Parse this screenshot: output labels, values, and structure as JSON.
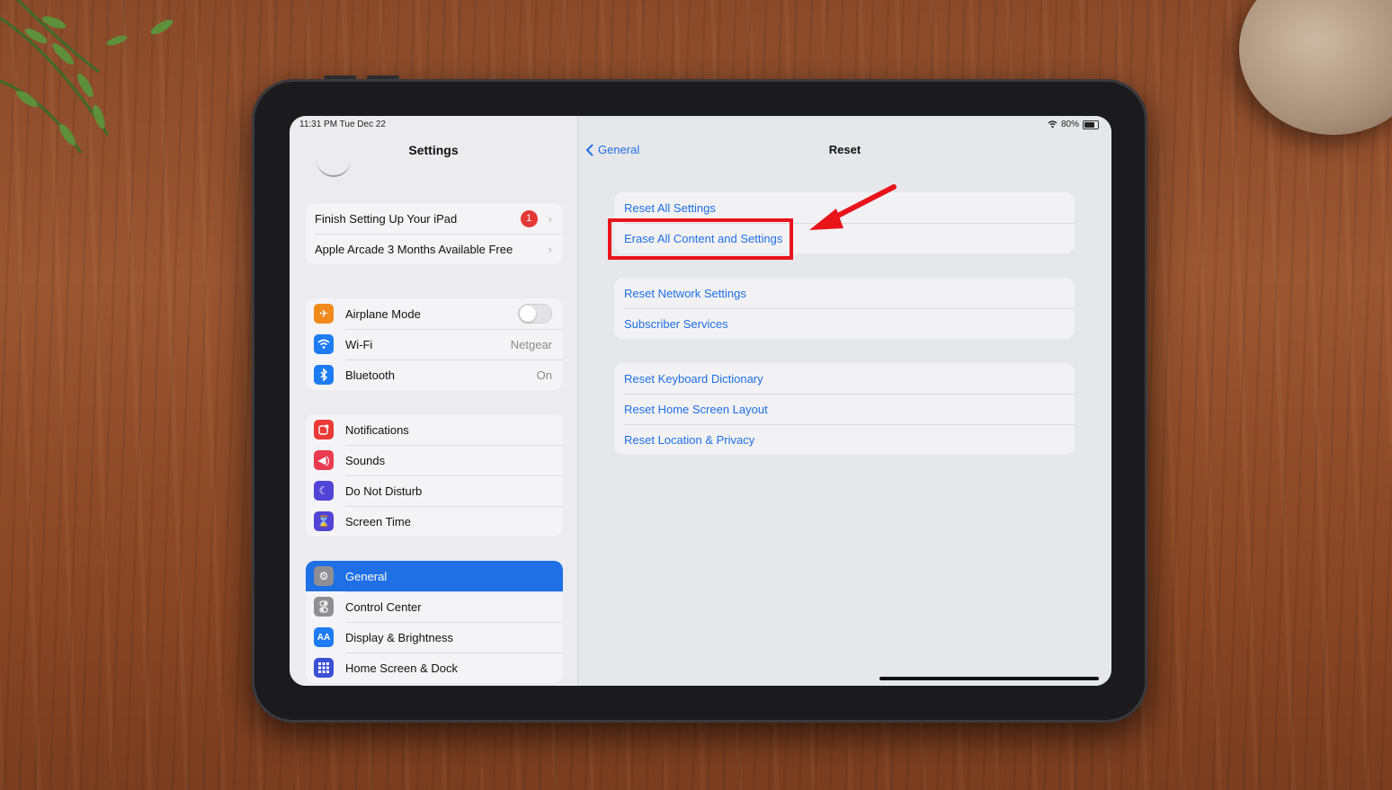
{
  "status_bar": {
    "time": "11:31 PM  Tue Dec 22",
    "battery": "80%"
  },
  "sidebar": {
    "title": "Settings",
    "promo_items": [
      {
        "label": "Finish Setting Up Your iPad",
        "badge": "1"
      },
      {
        "label": "Apple Arcade 3 Months Available Free"
      }
    ],
    "connectivity": [
      {
        "label": "Airplane Mode",
        "icon": "airplane-icon",
        "color": "#f08a1c"
      },
      {
        "label": "Wi-Fi",
        "value": "Netgear",
        "icon": "wifi-icon",
        "color": "#1e7cf2"
      },
      {
        "label": "Bluetooth",
        "value": "On",
        "icon": "bluetooth-icon",
        "color": "#1e7cf2"
      }
    ],
    "notifications": [
      {
        "label": "Notifications",
        "icon": "notifications-icon",
        "color": "#ea3b37"
      },
      {
        "label": "Sounds",
        "icon": "speaker-icon",
        "color": "#ea3b50"
      },
      {
        "label": "Do Not Disturb",
        "icon": "moon-icon",
        "color": "#5144d6"
      },
      {
        "label": "Screen Time",
        "icon": "hourglass-icon",
        "color": "#5144d6"
      }
    ],
    "general": [
      {
        "label": "General",
        "icon": "gear-icon",
        "color": "#8e8e93",
        "selected": true
      },
      {
        "label": "Control Center",
        "icon": "toggles-icon",
        "color": "#8e8e93"
      },
      {
        "label": "Display & Brightness",
        "icon": "text-size-icon",
        "color": "#1e7cf2"
      },
      {
        "label": "Home Screen & Dock",
        "icon": "grid-icon",
        "color": "#3b50d6"
      }
    ]
  },
  "main": {
    "back_label": "General",
    "title": "Reset",
    "group1": [
      "Reset All Settings",
      "Erase All Content and Settings"
    ],
    "group2": [
      "Reset Network Settings",
      "Subscriber Services"
    ],
    "group3": [
      "Reset Keyboard Dictionary",
      "Reset Home Screen Layout",
      "Reset Location & Privacy"
    ]
  },
  "accent_color": "#1f6fe5",
  "annotation_color": "#e8141a"
}
